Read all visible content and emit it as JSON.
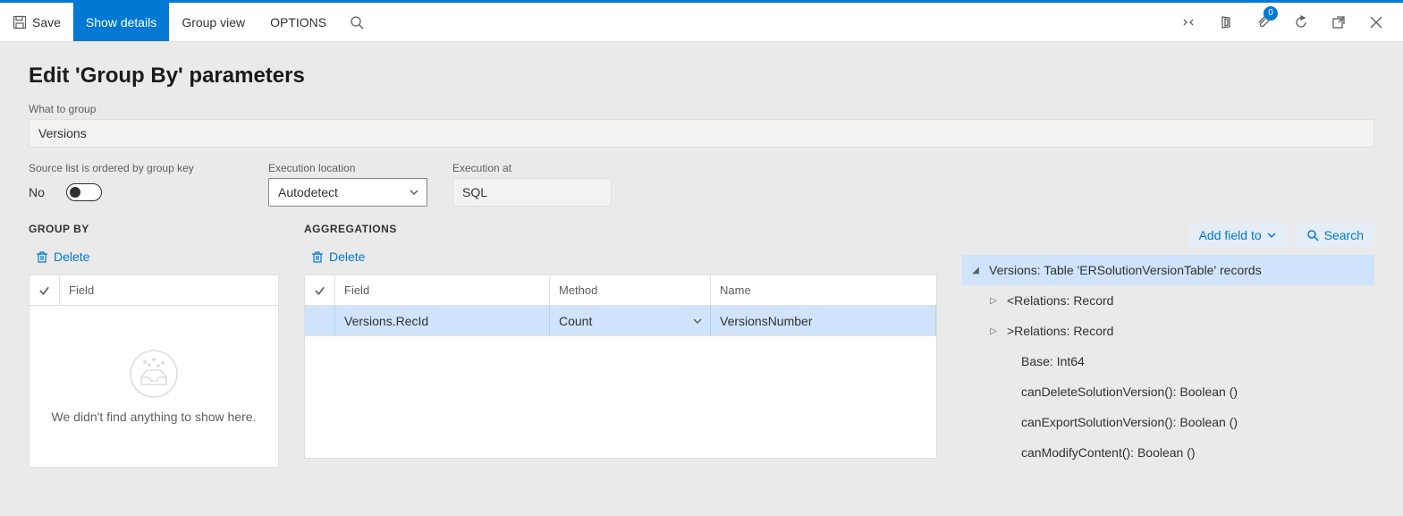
{
  "toolbar": {
    "save": "Save",
    "show_details": "Show details",
    "group_view": "Group view",
    "options": "OPTIONS",
    "attachment_badge": "0"
  },
  "page": {
    "title": "Edit 'Group By' parameters"
  },
  "what_to_group": {
    "label": "What to group",
    "value": "Versions"
  },
  "ordered_by_key": {
    "label": "Source list is ordered by group key",
    "value": "No"
  },
  "exec_location": {
    "label": "Execution location",
    "value": "Autodetect"
  },
  "exec_at": {
    "label": "Execution at",
    "value": "SQL"
  },
  "groupby": {
    "heading": "GROUP BY",
    "delete": "Delete",
    "col_field": "Field",
    "empty": "We didn't find anything to show here."
  },
  "agg": {
    "heading": "AGGREGATIONS",
    "delete": "Delete",
    "col_field": "Field",
    "col_method": "Method",
    "col_name": "Name",
    "rows": [
      {
        "field": "Versions.RecId",
        "method": "Count",
        "name": "VersionsNumber"
      }
    ]
  },
  "tree": {
    "add_field": "Add field to",
    "search": "Search",
    "root": "Versions: Table 'ERSolutionVersionTable' records",
    "nodes": [
      "<Relations: Record",
      ">Relations: Record",
      "Base: Int64",
      "canDeleteSolutionVersion(): Boolean ()",
      "canExportSolutionVersion(): Boolean ()",
      "canModifyContent(): Boolean ()"
    ]
  }
}
